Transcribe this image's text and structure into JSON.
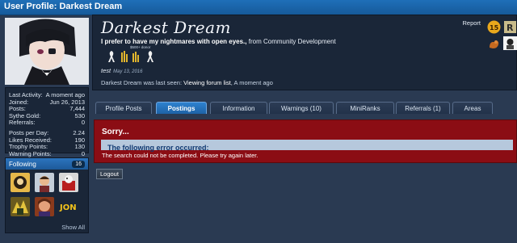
{
  "window": {
    "title": "User Profile: Darkest Dream"
  },
  "profile": {
    "username": "Darkest Dream",
    "user_title": "I prefer to have my nightmares with open eyes.,",
    "from_prefix": "from",
    "from_place": "Community Development",
    "donor_label": "$500+ donor",
    "status_user": "test",
    "status_date": "May 13, 2016",
    "seen_prefix": "Darkest Dream was last seen:",
    "seen_activity": "Viewing forum list",
    "seen_time": ", A moment ago",
    "report_label": "Report"
  },
  "stats": [
    {
      "label": "Last Activity:",
      "value": "A moment ago"
    },
    {
      "label": "Joined:",
      "value": "Jun 26, 2013"
    },
    {
      "label": "Posts:",
      "value": "7,444"
    },
    {
      "label": "Sythe Gold:",
      "value": "530"
    },
    {
      "label": "Referrals:",
      "value": "0"
    },
    {
      "label": "Posts per Day:",
      "value": "2.24"
    },
    {
      "label": "Likes Received:",
      "value": "190"
    },
    {
      "label": "Trophy Points:",
      "value": "130"
    },
    {
      "label": "Warning Points:",
      "value": "0"
    }
  ],
  "following": {
    "title": "Following",
    "count": "16",
    "show_all": "Show All"
  },
  "tabs": [
    {
      "label": "Profile Posts"
    },
    {
      "label": "Postings"
    },
    {
      "label": "Information"
    },
    {
      "label": "Warnings (10)"
    },
    {
      "label": "MiniRanks"
    },
    {
      "label": "Referrals (1)"
    },
    {
      "label": "Areas"
    }
  ],
  "error": {
    "heading": "Sorry...",
    "bar": "The following error occurred:",
    "message": "The search could not be completed. Please try again later."
  },
  "logout_label": "Logout",
  "trophy_badge": "15",
  "colors": {
    "accent": "#1e62a6",
    "error": "#8b0d14",
    "panel": "#1a2638"
  }
}
